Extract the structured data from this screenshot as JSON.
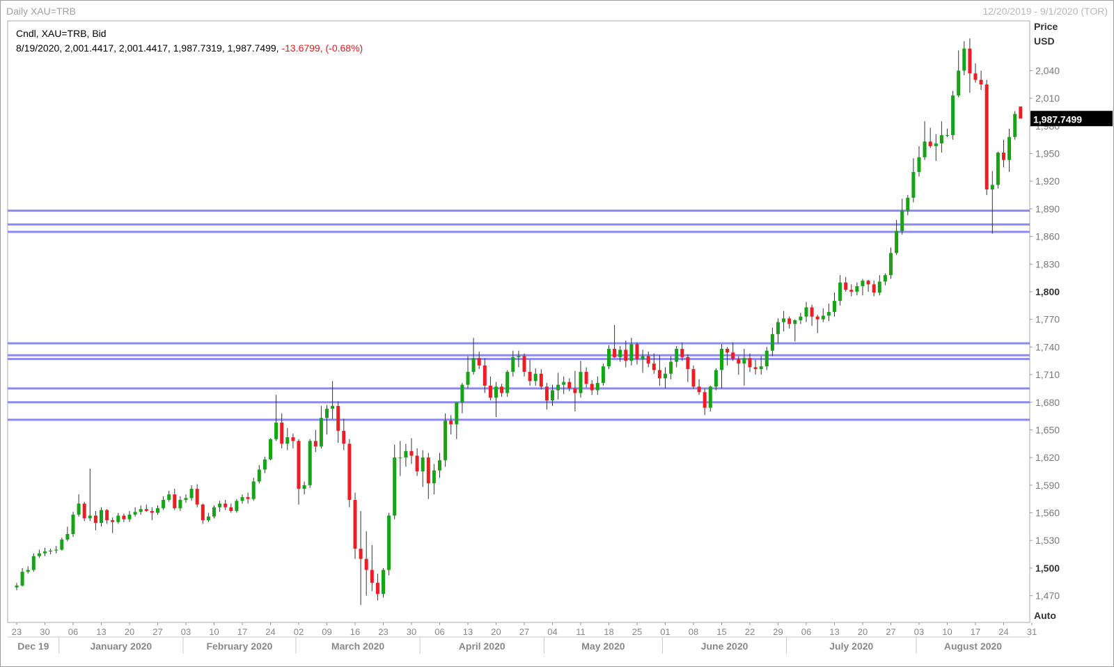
{
  "header": {
    "title": "Daily XAU=TRB",
    "date_range": "12/20/2019 - 9/1/2020 (TOR)"
  },
  "legend": {
    "line1": "Cndl, XAU=TRB, Bid",
    "ohlc": "8/19/2020, 2,001.4417, 2,001.4417, 1,987.7319, 1,987.7499,",
    "change": "-13.6799, (-0.68%)"
  },
  "axis": {
    "price_label": "Price",
    "currency_label": "USD",
    "auto_label": "Auto",
    "last_price_label": "1,987.7499"
  },
  "colors": {
    "up": "#16a316",
    "down": "#ee1c24",
    "level_line": "#8a8af2",
    "last_price_bg": "#000000"
  },
  "chart_data": {
    "type": "candlestick",
    "title": "Daily XAU=TRB",
    "ylabel": "Price USD",
    "ylim": [
      1441,
      2094
    ],
    "yticks": [
      {
        "v": 1470,
        "t": "1,470"
      },
      {
        "v": 1500,
        "t": "1,500",
        "major": true
      },
      {
        "v": 1530,
        "t": "1,530"
      },
      {
        "v": 1560,
        "t": "1,560"
      },
      {
        "v": 1590,
        "t": "1,590"
      },
      {
        "v": 1620,
        "t": "1,620"
      },
      {
        "v": 1650,
        "t": "1,650"
      },
      {
        "v": 1680,
        "t": "1,680"
      },
      {
        "v": 1710,
        "t": "1,710"
      },
      {
        "v": 1740,
        "t": "1,740"
      },
      {
        "v": 1770,
        "t": "1,770"
      },
      {
        "v": 1800,
        "t": "1,800",
        "major": true
      },
      {
        "v": 1830,
        "t": "1,830"
      },
      {
        "v": 1860,
        "t": "1,860"
      },
      {
        "v": 1890,
        "t": "1,890"
      },
      {
        "v": 1920,
        "t": "1,920"
      },
      {
        "v": 1950,
        "t": "1,950"
      },
      {
        "v": 1980,
        "t": "1,980"
      },
      {
        "v": 2010,
        "t": "2,010"
      },
      {
        "v": 2040,
        "t": "2,040"
      }
    ],
    "xticks": [
      {
        "i": 0,
        "t": "23"
      },
      {
        "i": 5,
        "t": "30"
      },
      {
        "i": 10,
        "t": "06"
      },
      {
        "i": 15,
        "t": "13"
      },
      {
        "i": 20,
        "t": "20"
      },
      {
        "i": 25,
        "t": "27"
      },
      {
        "i": 30,
        "t": "03"
      },
      {
        "i": 35,
        "t": "10"
      },
      {
        "i": 40,
        "t": "17"
      },
      {
        "i": 45,
        "t": "24"
      },
      {
        "i": 50,
        "t": "02"
      },
      {
        "i": 55,
        "t": "09"
      },
      {
        "i": 60,
        "t": "16"
      },
      {
        "i": 65,
        "t": "23"
      },
      {
        "i": 70,
        "t": "30"
      },
      {
        "i": 75,
        "t": "06"
      },
      {
        "i": 80,
        "t": "13"
      },
      {
        "i": 85,
        "t": "20"
      },
      {
        "i": 90,
        "t": "27"
      },
      {
        "i": 95,
        "t": "04"
      },
      {
        "i": 100,
        "t": "11"
      },
      {
        "i": 105,
        "t": "18"
      },
      {
        "i": 110,
        "t": "25"
      },
      {
        "i": 115,
        "t": "01"
      },
      {
        "i": 120,
        "t": "08"
      },
      {
        "i": 125,
        "t": "15"
      },
      {
        "i": 130,
        "t": "22"
      },
      {
        "i": 135,
        "t": "29"
      },
      {
        "i": 140,
        "t": "06"
      },
      {
        "i": 145,
        "t": "13"
      },
      {
        "i": 150,
        "t": "20"
      },
      {
        "i": 155,
        "t": "27"
      },
      {
        "i": 160,
        "t": "03"
      },
      {
        "i": 165,
        "t": "10"
      },
      {
        "i": 170,
        "t": "17"
      },
      {
        "i": 175,
        "t": "24"
      },
      {
        "i": 180,
        "t": "31"
      }
    ],
    "months": [
      {
        "start": -2,
        "end": 7,
        "t": "Dec 19"
      },
      {
        "start": 8,
        "end": 29,
        "t": "January 2020"
      },
      {
        "start": 30,
        "end": 49,
        "t": "February 2020"
      },
      {
        "start": 50,
        "end": 71,
        "t": "March 2020"
      },
      {
        "start": 72,
        "end": 93,
        "t": "April 2020"
      },
      {
        "start": 94,
        "end": 114,
        "t": "May 2020"
      },
      {
        "start": 115,
        "end": 136,
        "t": "June 2020"
      },
      {
        "start": 137,
        "end": 159,
        "t": "July 2020"
      },
      {
        "start": 160,
        "end": 181,
        "t": "August 2020"
      }
    ],
    "levels": [
      1888,
      1873,
      1865,
      1744,
      1731,
      1727,
      1695,
      1680,
      1661
    ],
    "candles": [
      [
        1479,
        1484,
        1476,
        1481
      ],
      [
        1481,
        1500,
        1480,
        1496
      ],
      [
        1496,
        1502,
        1494,
        1498
      ],
      [
        1498,
        1516,
        1496,
        1513
      ],
      [
        1513,
        1520,
        1511,
        1516
      ],
      [
        1516,
        1522,
        1513,
        1518
      ],
      [
        1518,
        1521,
        1515,
        1519
      ],
      [
        1519,
        1524,
        1516,
        1520
      ],
      [
        1520,
        1533,
        1519,
        1531
      ],
      [
        1531,
        1545,
        1529,
        1537
      ],
      [
        1537,
        1561,
        1534,
        1558
      ],
      [
        1558,
        1580,
        1556,
        1570
      ],
      [
        1570,
        1572,
        1551,
        1554
      ],
      [
        1554,
        1608,
        1551,
        1557
      ],
      [
        1557,
        1562,
        1541,
        1549
      ],
      [
        1549,
        1566,
        1545,
        1563
      ],
      [
        1563,
        1564,
        1548,
        1552
      ],
      [
        1552,
        1555,
        1538,
        1550
      ],
      [
        1550,
        1560,
        1548,
        1557
      ],
      [
        1557,
        1559,
        1550,
        1553
      ],
      [
        1553,
        1562,
        1550,
        1558
      ],
      [
        1558,
        1566,
        1556,
        1561
      ],
      [
        1561,
        1568,
        1558,
        1564
      ],
      [
        1564,
        1569,
        1561,
        1562
      ],
      [
        1562,
        1566,
        1552,
        1560
      ],
      [
        1560,
        1568,
        1558,
        1565
      ],
      [
        1565,
        1578,
        1563,
        1574
      ],
      [
        1574,
        1584,
        1572,
        1580
      ],
      [
        1580,
        1586,
        1563,
        1565
      ],
      [
        1565,
        1578,
        1562,
        1574
      ],
      [
        1574,
        1580,
        1571,
        1576
      ],
      [
        1576,
        1590,
        1573,
        1586
      ],
      [
        1586,
        1591,
        1566,
        1569
      ],
      [
        1569,
        1570,
        1548,
        1552
      ],
      [
        1552,
        1560,
        1550,
        1556
      ],
      [
        1556,
        1568,
        1554,
        1566
      ],
      [
        1566,
        1573,
        1561,
        1570
      ],
      [
        1570,
        1574,
        1563,
        1566
      ],
      [
        1566,
        1570,
        1560,
        1562
      ],
      [
        1562,
        1575,
        1560,
        1573
      ],
      [
        1573,
        1580,
        1570,
        1577
      ],
      [
        1577,
        1582,
        1570,
        1575
      ],
      [
        1575,
        1598,
        1573,
        1594
      ],
      [
        1594,
        1612,
        1592,
        1607
      ],
      [
        1607,
        1621,
        1603,
        1618
      ],
      [
        1618,
        1641,
        1617,
        1640
      ],
      [
        1640,
        1688,
        1638,
        1658
      ],
      [
        1658,
        1668,
        1630,
        1635
      ],
      [
        1635,
        1652,
        1628,
        1642
      ],
      [
        1642,
        1646,
        1630,
        1638
      ],
      [
        1638,
        1640,
        1569,
        1586
      ],
      [
        1586,
        1594,
        1580,
        1590
      ],
      [
        1590,
        1640,
        1587,
        1638
      ],
      [
        1638,
        1650,
        1626,
        1632
      ],
      [
        1632,
        1676,
        1630,
        1663
      ],
      [
        1663,
        1677,
        1645,
        1673
      ],
      [
        1673,
        1703,
        1662,
        1676
      ],
      [
        1676,
        1681,
        1636,
        1649
      ],
      [
        1649,
        1662,
        1628,
        1635
      ],
      [
        1635,
        1640,
        1566,
        1574
      ],
      [
        1574,
        1582,
        1510,
        1521
      ],
      [
        1521,
        1562,
        1460,
        1510
      ],
      [
        1510,
        1540,
        1470,
        1498
      ],
      [
        1498,
        1525,
        1475,
        1484
      ],
      [
        1484,
        1494,
        1465,
        1472
      ],
      [
        1472,
        1500,
        1468,
        1498
      ],
      [
        1498,
        1560,
        1492,
        1557
      ],
      [
        1557,
        1634,
        1553,
        1620
      ],
      [
        1620,
        1638,
        1600,
        1620
      ],
      [
        1620,
        1635,
        1610,
        1627
      ],
      [
        1627,
        1641,
        1613,
        1622
      ],
      [
        1622,
        1630,
        1600,
        1605
      ],
      [
        1605,
        1628,
        1588,
        1620
      ],
      [
        1620,
        1625,
        1575,
        1592
      ],
      [
        1592,
        1613,
        1580,
        1606
      ],
      [
        1606,
        1625,
        1598,
        1617
      ],
      [
        1617,
        1668,
        1610,
        1660
      ],
      [
        1660,
        1666,
        1645,
        1656
      ],
      [
        1656,
        1672,
        1640,
        1680
      ],
      [
        1680,
        1701,
        1668,
        1699
      ],
      [
        1699,
        1730,
        1695,
        1713
      ],
      [
        1713,
        1750,
        1710,
        1728
      ],
      [
        1728,
        1735,
        1716,
        1720
      ],
      [
        1720,
        1728,
        1690,
        1698
      ],
      [
        1698,
        1708,
        1682,
        1685
      ],
      [
        1685,
        1702,
        1664,
        1697
      ],
      [
        1697,
        1700,
        1686,
        1690
      ],
      [
        1690,
        1715,
        1686,
        1713
      ],
      [
        1713,
        1736,
        1708,
        1729
      ],
      [
        1729,
        1736,
        1718,
        1730
      ],
      [
        1730,
        1733,
        1708,
        1713
      ],
      [
        1713,
        1726,
        1698,
        1703
      ],
      [
        1703,
        1717,
        1698,
        1711
      ],
      [
        1711,
        1716,
        1694,
        1697
      ],
      [
        1697,
        1701,
        1672,
        1682
      ],
      [
        1682,
        1699,
        1676,
        1693
      ],
      [
        1693,
        1712,
        1683,
        1699
      ],
      [
        1699,
        1708,
        1689,
        1702
      ],
      [
        1702,
        1706,
        1692,
        1695
      ],
      [
        1695,
        1714,
        1670,
        1690
      ],
      [
        1690,
        1725,
        1685,
        1713
      ],
      [
        1713,
        1718,
        1696,
        1700
      ],
      [
        1700,
        1704,
        1688,
        1693
      ],
      [
        1693,
        1708,
        1688,
        1701
      ],
      [
        1701,
        1722,
        1698,
        1719
      ],
      [
        1719,
        1742,
        1716,
        1738
      ],
      [
        1738,
        1764,
        1728,
        1729
      ],
      [
        1729,
        1741,
        1724,
        1737
      ],
      [
        1737,
        1747,
        1718,
        1725
      ],
      [
        1725,
        1750,
        1720,
        1743
      ],
      [
        1743,
        1745,
        1721,
        1727
      ],
      [
        1727,
        1737,
        1712,
        1730
      ],
      [
        1730,
        1735,
        1718,
        1722
      ],
      [
        1722,
        1733,
        1711,
        1715
      ],
      [
        1715,
        1731,
        1698,
        1706
      ],
      [
        1706,
        1718,
        1695,
        1711
      ],
      [
        1711,
        1730,
        1705,
        1724
      ],
      [
        1724,
        1741,
        1718,
        1738
      ],
      [
        1738,
        1745,
        1725,
        1729
      ],
      [
        1729,
        1732,
        1702,
        1716
      ],
      [
        1716,
        1720,
        1695,
        1697
      ],
      [
        1697,
        1705,
        1688,
        1691
      ],
      [
        1691,
        1695,
        1666,
        1674
      ],
      [
        1674,
        1698,
        1670,
        1697
      ],
      [
        1697,
        1717,
        1693,
        1715
      ],
      [
        1715,
        1743,
        1695,
        1738
      ],
      [
        1738,
        1740,
        1720,
        1734
      ],
      [
        1734,
        1745,
        1725,
        1727
      ],
      [
        1727,
        1730,
        1710,
        1722
      ],
      [
        1722,
        1738,
        1698,
        1728
      ],
      [
        1728,
        1733,
        1713,
        1718
      ],
      [
        1718,
        1726,
        1710,
        1716
      ],
      [
        1716,
        1730,
        1710,
        1719
      ],
      [
        1719,
        1740,
        1715,
        1736
      ],
      [
        1736,
        1761,
        1730,
        1754
      ],
      [
        1754,
        1771,
        1744,
        1767
      ],
      [
        1767,
        1779,
        1757,
        1771
      ],
      [
        1771,
        1773,
        1760,
        1765
      ],
      [
        1765,
        1770,
        1746,
        1769
      ],
      [
        1769,
        1777,
        1765,
        1773
      ],
      [
        1773,
        1789,
        1767,
        1783
      ],
      [
        1783,
        1786,
        1763,
        1773
      ],
      [
        1773,
        1775,
        1755,
        1770
      ],
      [
        1770,
        1782,
        1767,
        1774
      ],
      [
        1774,
        1787,
        1768,
        1778
      ],
      [
        1778,
        1799,
        1773,
        1790
      ],
      [
        1790,
        1818,
        1785,
        1810
      ],
      [
        1810,
        1816,
        1800,
        1802
      ],
      [
        1802,
        1808,
        1795,
        1800
      ],
      [
        1800,
        1810,
        1796,
        1806
      ],
      [
        1806,
        1814,
        1796,
        1812
      ],
      [
        1812,
        1813,
        1800,
        1808
      ],
      [
        1808,
        1812,
        1795,
        1799
      ],
      [
        1799,
        1818,
        1796,
        1811
      ],
      [
        1811,
        1820,
        1807,
        1818
      ],
      [
        1818,
        1848,
        1814,
        1842
      ],
      [
        1842,
        1878,
        1840,
        1866
      ],
      [
        1866,
        1901,
        1862,
        1888
      ],
      [
        1888,
        1905,
        1883,
        1902
      ],
      [
        1902,
        1945,
        1897,
        1930
      ],
      [
        1930,
        1958,
        1925,
        1946
      ],
      [
        1946,
        1985,
        1943,
        1963
      ],
      [
        1963,
        1978,
        1956,
        1958
      ],
      [
        1958,
        1971,
        1942,
        1961
      ],
      [
        1961,
        1985,
        1951,
        1970
      ],
      [
        1970,
        1977,
        1968,
        1970
      ],
      [
        1970,
        2018,
        1965,
        2013
      ],
      [
        2013,
        2062,
        2011,
        2040
      ],
      [
        2040,
        2072,
        2035,
        2064
      ],
      [
        2064,
        2075,
        2016,
        2037
      ],
      [
        2037,
        2048,
        2027,
        2030
      ],
      [
        2030,
        2040,
        2019,
        2025
      ],
      [
        2025,
        2030,
        1905,
        1911
      ],
      [
        1911,
        1931,
        1863,
        1916
      ],
      [
        1916,
        1952,
        1912,
        1951
      ],
      [
        1951,
        1965,
        1935,
        1943
      ],
      [
        1943,
        1977,
        1930,
        1968
      ],
      [
        1968,
        1996,
        1965,
        1993
      ],
      [
        2001,
        2001,
        1988,
        1988
      ]
    ]
  }
}
